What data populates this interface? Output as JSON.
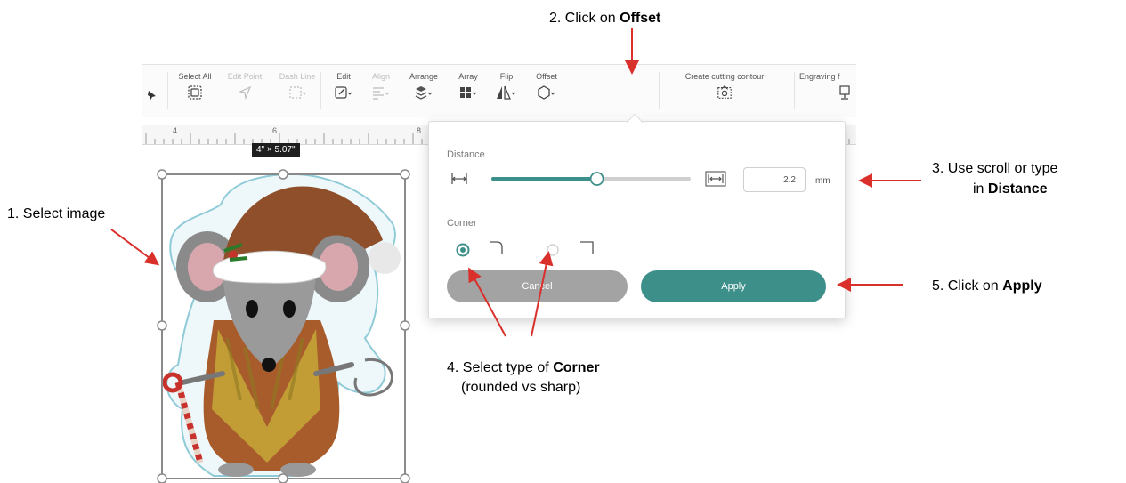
{
  "toolbar": {
    "select_all": "Select All",
    "edit_point": "Edit Point",
    "dash_line": "Dash Line",
    "edit": "Edit",
    "align": "Align",
    "arrange": "Arrange",
    "array": "Array",
    "flip": "Flip",
    "offset": "Offset",
    "create_cutting_contour": "Create cutting contour",
    "engraving": "Engraving f"
  },
  "ruler": {
    "marks": [
      "4",
      "6",
      "8"
    ]
  },
  "selection": {
    "dimensions": "4\" × 5.07\""
  },
  "offset_popup": {
    "distance_label": "Distance",
    "distance_value": "2.2",
    "distance_unit": "mm",
    "slider_fraction": 0.53,
    "corner_label": "Corner",
    "corner_selected": "rounded",
    "cancel_label": "Cancel",
    "apply_label": "Apply"
  },
  "callouts": {
    "step1": "1. Select image",
    "step2_prefix": "2. Click on ",
    "step2_bold": "Offset",
    "step3_line1": "3. Use scroll or type",
    "step3_prefix": "in ",
    "step3_bold": "Distance",
    "step4_prefix": "4. Select type of ",
    "step4_bold": "Corner",
    "step4_line2": "(rounded vs sharp)",
    "step5_prefix": "5. Click on ",
    "step5_bold": "Apply"
  },
  "colors": {
    "accent": "#3d8f8a",
    "arrow": "#d9302c",
    "cancel": "#a3a3a3"
  },
  "icons": [
    "pin-icon",
    "select-all-icon",
    "edit-point-icon",
    "dash-line-icon",
    "edit-icon",
    "align-icon",
    "arrange-icon",
    "array-icon",
    "flip-icon",
    "offset-icon",
    "cutting-contour-icon",
    "engraving-icon",
    "distance-min-icon",
    "distance-max-icon"
  ]
}
